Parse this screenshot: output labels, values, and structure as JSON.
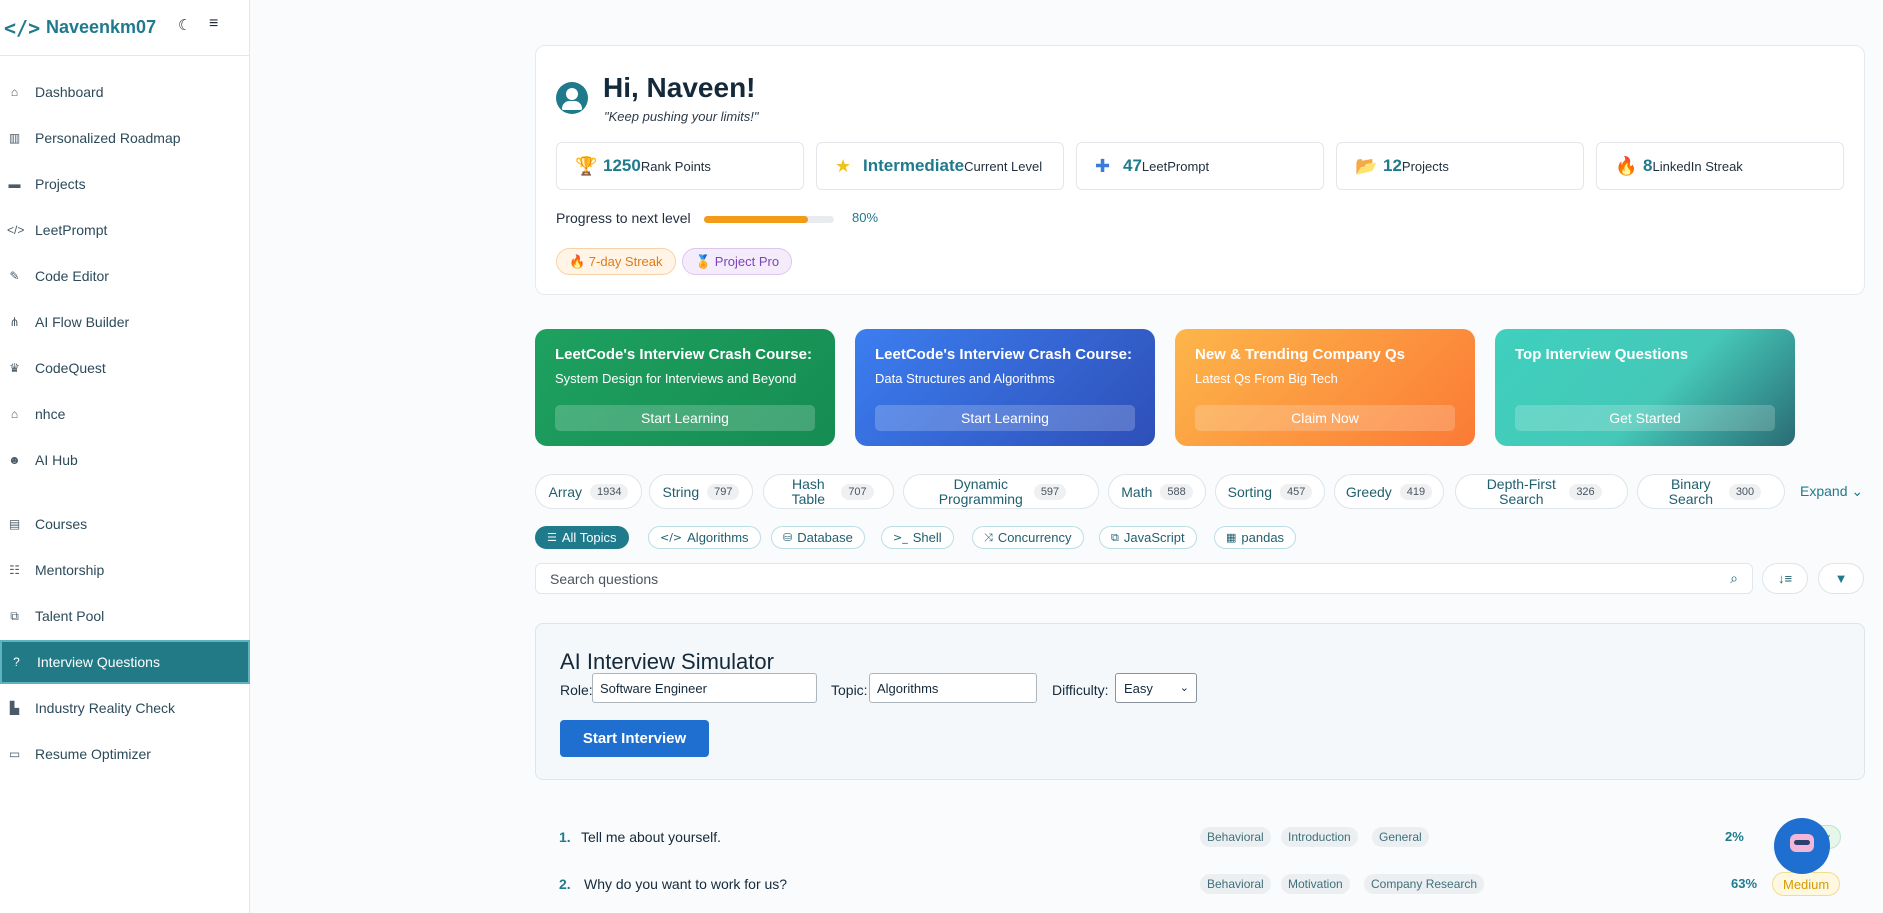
{
  "brand": {
    "logo": "</>",
    "name": "Naveenkm07"
  },
  "sidebar": {
    "items": [
      {
        "label": "Dashboard",
        "icon": "⌂"
      },
      {
        "label": "Personalized Roadmap",
        "icon": "▥"
      },
      {
        "label": "Projects",
        "icon": "▬"
      },
      {
        "label": "LeetPrompt",
        "icon": "</>"
      },
      {
        "label": "Code Editor",
        "icon": "✎"
      },
      {
        "label": "AI Flow Builder",
        "icon": "⋔"
      },
      {
        "label": "CodeQuest",
        "icon": "♛"
      },
      {
        "label": "nhce",
        "icon": "⌂"
      },
      {
        "label": "AI Hub",
        "icon": "☻"
      },
      {
        "label": "Courses",
        "icon": "▤"
      },
      {
        "label": "Mentorship",
        "icon": "☷"
      },
      {
        "label": "Talent Pool",
        "icon": "⧉"
      },
      {
        "label": "Interview Questions",
        "icon": "?"
      },
      {
        "label": "Industry Reality Check",
        "icon": "▙"
      },
      {
        "label": "Resume Optimizer",
        "icon": "▭"
      }
    ],
    "active": "Interview Questions"
  },
  "profile": {
    "greeting": "Hi, Naveen!",
    "quote": "\"Keep pushing your limits!\"",
    "stats": [
      {
        "value": "1250",
        "label": "Rank Points",
        "icon": "🏆"
      },
      {
        "value": "Intermediate",
        "label": "Current Level",
        "icon": "★"
      },
      {
        "value": "47",
        "label": "LeetPrompt",
        "icon": "✚"
      },
      {
        "value": "12",
        "label": "Projects",
        "icon": "📂"
      },
      {
        "value": "8",
        "label": "LinkedIn Streak",
        "icon": "🔥"
      }
    ],
    "progress_label": "Progress to next level",
    "progress_pct": "80%",
    "progress_fraction": 0.8,
    "badges": [
      "🔥 7-day Streak",
      "🏅 Project Pro"
    ]
  },
  "promos": [
    {
      "title": "LeetCode's Interview Crash Course:",
      "subtitle": "System Design for Interviews and Beyond",
      "button": "Start Learning"
    },
    {
      "title": "LeetCode's Interview Crash Course:",
      "subtitle": "Data Structures and Algorithms",
      "button": "Start Learning"
    },
    {
      "title": "New & Trending Company Qs",
      "subtitle": "Latest Qs From Big Tech",
      "button": "Claim Now"
    },
    {
      "title": "Top Interview Questions",
      "subtitle": "",
      "button": "Get Started"
    }
  ],
  "tags": [
    {
      "name": "Array",
      "count": "1934"
    },
    {
      "name": "String",
      "count": "797"
    },
    {
      "name": "Hash Table",
      "count": "707"
    },
    {
      "name": "Dynamic Programming",
      "count": "597"
    },
    {
      "name": "Math",
      "count": "588"
    },
    {
      "name": "Sorting",
      "count": "457"
    },
    {
      "name": "Greedy",
      "count": "419"
    },
    {
      "name": "Depth-First Search",
      "count": "326"
    },
    {
      "name": "Binary Search",
      "count": "300"
    }
  ],
  "expand_label": "Expand",
  "topics": [
    "All Topics",
    "Algorithms",
    "Database",
    "Shell",
    "Concurrency",
    "JavaScript",
    "pandas"
  ],
  "search": {
    "placeholder": "Search questions"
  },
  "simulator": {
    "title": "AI Interview Simulator",
    "role_label": "Role:",
    "role_value": "Software Engineer",
    "topic_label": "Topic:",
    "topic_value": "Algorithms",
    "difficulty_label": "Difficulty:",
    "difficulty_value": "Easy",
    "start_button": "Start Interview"
  },
  "questions": [
    {
      "num": "1.",
      "text": "Tell me about yourself.",
      "tags": [
        "Behavioral",
        "Introduction",
        "General"
      ],
      "pct": "2%",
      "difficulty": "Easy"
    },
    {
      "num": "2.",
      "text": "Why do you want to work for us?",
      "tags": [
        "Behavioral",
        "Motivation",
        "Company Research"
      ],
      "pct": "63%",
      "difficulty": "Medium"
    }
  ]
}
